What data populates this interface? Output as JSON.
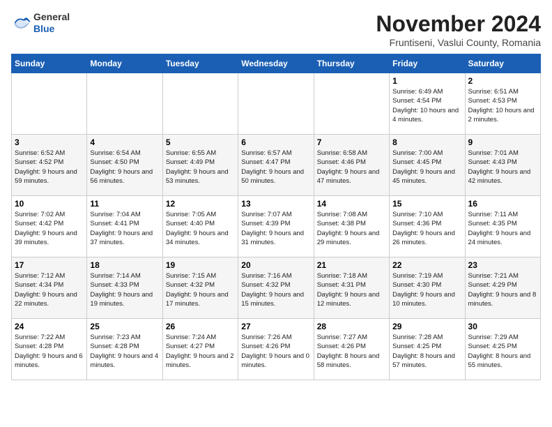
{
  "header": {
    "logo_general": "General",
    "logo_blue": "Blue",
    "month_title": "November 2024",
    "location": "Fruntiseni, Vaslui County, Romania"
  },
  "weekdays": [
    "Sunday",
    "Monday",
    "Tuesday",
    "Wednesday",
    "Thursday",
    "Friday",
    "Saturday"
  ],
  "weeks": [
    [
      {
        "day": "",
        "info": ""
      },
      {
        "day": "",
        "info": ""
      },
      {
        "day": "",
        "info": ""
      },
      {
        "day": "",
        "info": ""
      },
      {
        "day": "",
        "info": ""
      },
      {
        "day": "1",
        "info": "Sunrise: 6:49 AM\nSunset: 4:54 PM\nDaylight: 10 hours and 4 minutes."
      },
      {
        "day": "2",
        "info": "Sunrise: 6:51 AM\nSunset: 4:53 PM\nDaylight: 10 hours and 2 minutes."
      }
    ],
    [
      {
        "day": "3",
        "info": "Sunrise: 6:52 AM\nSunset: 4:52 PM\nDaylight: 9 hours and 59 minutes."
      },
      {
        "day": "4",
        "info": "Sunrise: 6:54 AM\nSunset: 4:50 PM\nDaylight: 9 hours and 56 minutes."
      },
      {
        "day": "5",
        "info": "Sunrise: 6:55 AM\nSunset: 4:49 PM\nDaylight: 9 hours and 53 minutes."
      },
      {
        "day": "6",
        "info": "Sunrise: 6:57 AM\nSunset: 4:47 PM\nDaylight: 9 hours and 50 minutes."
      },
      {
        "day": "7",
        "info": "Sunrise: 6:58 AM\nSunset: 4:46 PM\nDaylight: 9 hours and 47 minutes."
      },
      {
        "day": "8",
        "info": "Sunrise: 7:00 AM\nSunset: 4:45 PM\nDaylight: 9 hours and 45 minutes."
      },
      {
        "day": "9",
        "info": "Sunrise: 7:01 AM\nSunset: 4:43 PM\nDaylight: 9 hours and 42 minutes."
      }
    ],
    [
      {
        "day": "10",
        "info": "Sunrise: 7:02 AM\nSunset: 4:42 PM\nDaylight: 9 hours and 39 minutes."
      },
      {
        "day": "11",
        "info": "Sunrise: 7:04 AM\nSunset: 4:41 PM\nDaylight: 9 hours and 37 minutes."
      },
      {
        "day": "12",
        "info": "Sunrise: 7:05 AM\nSunset: 4:40 PM\nDaylight: 9 hours and 34 minutes."
      },
      {
        "day": "13",
        "info": "Sunrise: 7:07 AM\nSunset: 4:39 PM\nDaylight: 9 hours and 31 minutes."
      },
      {
        "day": "14",
        "info": "Sunrise: 7:08 AM\nSunset: 4:38 PM\nDaylight: 9 hours and 29 minutes."
      },
      {
        "day": "15",
        "info": "Sunrise: 7:10 AM\nSunset: 4:36 PM\nDaylight: 9 hours and 26 minutes."
      },
      {
        "day": "16",
        "info": "Sunrise: 7:11 AM\nSunset: 4:35 PM\nDaylight: 9 hours and 24 minutes."
      }
    ],
    [
      {
        "day": "17",
        "info": "Sunrise: 7:12 AM\nSunset: 4:34 PM\nDaylight: 9 hours and 22 minutes."
      },
      {
        "day": "18",
        "info": "Sunrise: 7:14 AM\nSunset: 4:33 PM\nDaylight: 9 hours and 19 minutes."
      },
      {
        "day": "19",
        "info": "Sunrise: 7:15 AM\nSunset: 4:32 PM\nDaylight: 9 hours and 17 minutes."
      },
      {
        "day": "20",
        "info": "Sunrise: 7:16 AM\nSunset: 4:32 PM\nDaylight: 9 hours and 15 minutes."
      },
      {
        "day": "21",
        "info": "Sunrise: 7:18 AM\nSunset: 4:31 PM\nDaylight: 9 hours and 12 minutes."
      },
      {
        "day": "22",
        "info": "Sunrise: 7:19 AM\nSunset: 4:30 PM\nDaylight: 9 hours and 10 minutes."
      },
      {
        "day": "23",
        "info": "Sunrise: 7:21 AM\nSunset: 4:29 PM\nDaylight: 9 hours and 8 minutes."
      }
    ],
    [
      {
        "day": "24",
        "info": "Sunrise: 7:22 AM\nSunset: 4:28 PM\nDaylight: 9 hours and 6 minutes."
      },
      {
        "day": "25",
        "info": "Sunrise: 7:23 AM\nSunset: 4:28 PM\nDaylight: 9 hours and 4 minutes."
      },
      {
        "day": "26",
        "info": "Sunrise: 7:24 AM\nSunset: 4:27 PM\nDaylight: 9 hours and 2 minutes."
      },
      {
        "day": "27",
        "info": "Sunrise: 7:26 AM\nSunset: 4:26 PM\nDaylight: 9 hours and 0 minutes."
      },
      {
        "day": "28",
        "info": "Sunrise: 7:27 AM\nSunset: 4:26 PM\nDaylight: 8 hours and 58 minutes."
      },
      {
        "day": "29",
        "info": "Sunrise: 7:28 AM\nSunset: 4:25 PM\nDaylight: 8 hours and 57 minutes."
      },
      {
        "day": "30",
        "info": "Sunrise: 7:29 AM\nSunset: 4:25 PM\nDaylight: 8 hours and 55 minutes."
      }
    ]
  ]
}
